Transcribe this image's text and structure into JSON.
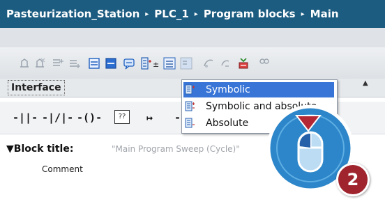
{
  "breadcrumb": {
    "items": [
      "Pasteurization_Station",
      "PLC_1",
      "Program blocks",
      "Main"
    ],
    "separator": "▸"
  },
  "interface_tab": {
    "label": "Interface"
  },
  "view_menu": {
    "items": [
      {
        "label": "Symbolic",
        "selected": true
      },
      {
        "label": "Symbolic and absolute",
        "selected": false
      },
      {
        "label": "Absolute",
        "selected": false
      }
    ]
  },
  "ladder_toolbar": {
    "box_label": "??"
  },
  "block": {
    "title_label": "Block title:",
    "title_hint": "\"Main Program Sweep (Cycle)\"",
    "comment": "Comment"
  },
  "step_badge": {
    "number": "2"
  },
  "colors": {
    "titlebar": "#1c5c80",
    "selection": "#3875d7",
    "callout": "#2c86c9",
    "badge": "#a0242e",
    "arrow": "#b32633"
  }
}
